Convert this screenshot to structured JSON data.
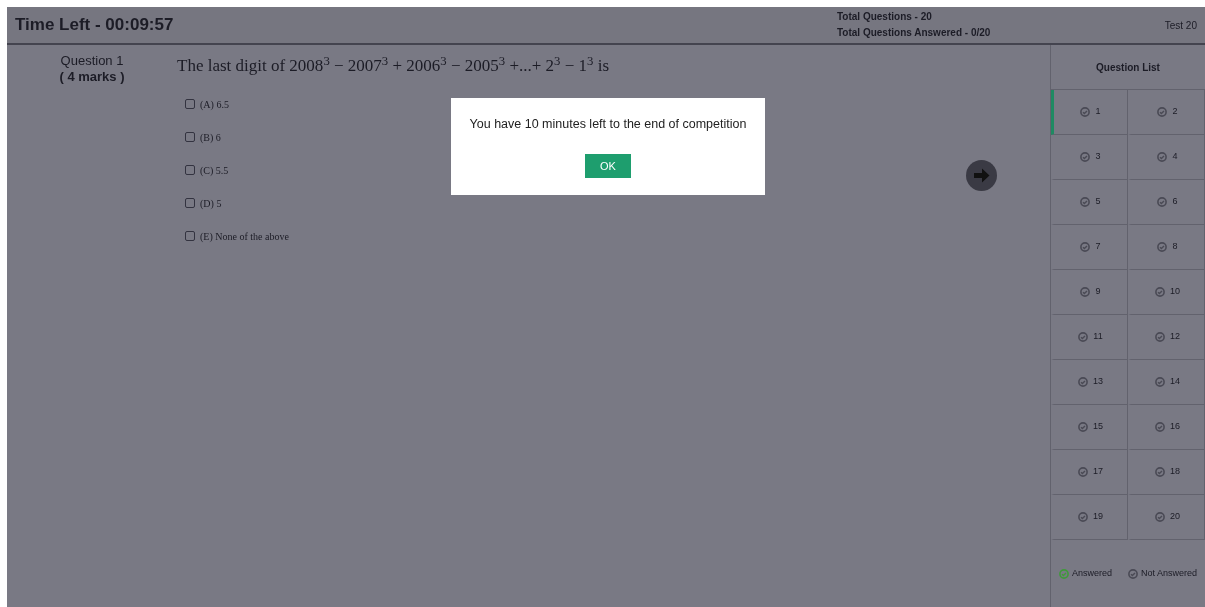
{
  "header": {
    "timer": "Time Left - 00:09:57",
    "total_questions": "Total Questions - 20",
    "total_answered": "Total Questions Answered - 0/20",
    "test_name": "Test 20"
  },
  "question": {
    "number": "Question 1",
    "marks": "( 4 marks )",
    "text": "The last digit of 2008$^{3}$ − 2007$^{3}$ + 2006$^{3}$ − 2005$^{3}$ +...+ 2$^{3}$ − 1$^{3}$ is",
    "options": [
      {
        "label": "(A) 6.5",
        "checked": false
      },
      {
        "label": "(B) 6",
        "checked": false
      },
      {
        "label": "(C) 5.5",
        "checked": false
      },
      {
        "label": "(D) 5",
        "checked": false
      },
      {
        "label": "(E) None of the above",
        "checked": false
      }
    ]
  },
  "question_list": {
    "title": "Question List",
    "items": [
      {
        "label": "1",
        "selected": true,
        "answered": false
      },
      {
        "label": "2",
        "selected": false,
        "answered": false
      },
      {
        "label": "3",
        "selected": false,
        "answered": false
      },
      {
        "label": "4",
        "selected": false,
        "answered": false
      },
      {
        "label": "5",
        "selected": false,
        "answered": false
      },
      {
        "label": "6",
        "selected": false,
        "answered": false
      },
      {
        "label": "7",
        "selected": false,
        "answered": false
      },
      {
        "label": "8",
        "selected": false,
        "answered": false
      },
      {
        "label": "9",
        "selected": false,
        "answered": false
      },
      {
        "label": "10",
        "selected": false,
        "answered": false
      },
      {
        "label": "11",
        "selected": false,
        "answered": false
      },
      {
        "label": "12",
        "selected": false,
        "answered": false
      },
      {
        "label": "13",
        "selected": false,
        "answered": false
      },
      {
        "label": "14",
        "selected": false,
        "answered": false
      },
      {
        "label": "15",
        "selected": false,
        "answered": false
      },
      {
        "label": "16",
        "selected": false,
        "answered": false
      },
      {
        "label": "17",
        "selected": false,
        "answered": false
      },
      {
        "label": "18",
        "selected": false,
        "answered": false
      },
      {
        "label": "19",
        "selected": false,
        "answered": false
      },
      {
        "label": "20",
        "selected": false,
        "answered": false
      }
    ],
    "legend": [
      {
        "label": "Answered",
        "color": "#3f9a3a"
      },
      {
        "label": "Not Answered",
        "color": "#4a4a55"
      }
    ]
  },
  "dialog": {
    "message": "You have 10 minutes left to the end of competition",
    "button": "OK"
  }
}
